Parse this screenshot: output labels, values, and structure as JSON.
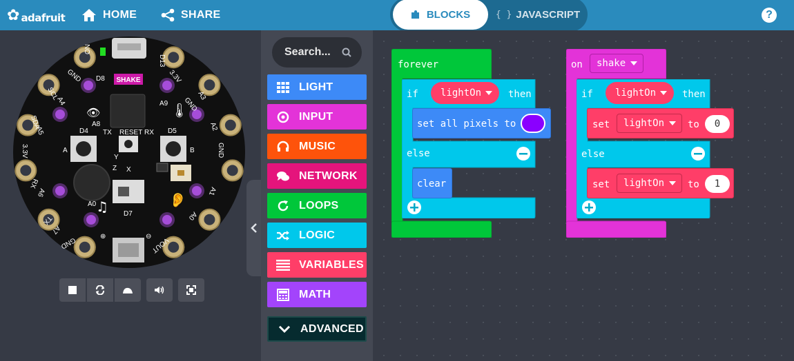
{
  "topbar": {
    "brand": "adafruit",
    "home_label": "HOME",
    "share_label": "SHARE",
    "tabs": {
      "blocks_label": "BLOCKS",
      "js_brace": "{ }",
      "javascript_label": "JAVASCRIPT"
    },
    "help_label": "?",
    "colors": {
      "bar": "#2a8bbd"
    }
  },
  "simulator": {
    "labels": {
      "on": "ON",
      "d13": "D13",
      "gnd_tl": "GND",
      "gnd_br": "GND",
      "gnd_bl": "GND",
      "gnd_r": "GND",
      "d8": "D8",
      "shake": "SHAKE",
      "v33_tr": "3.3V",
      "scl": "SCL",
      "a4": "A4",
      "a3": "A3",
      "a8": "A8",
      "a9": "A9",
      "sda": "SDA",
      "a5": "A5",
      "a2": "A2",
      "d4": "D4",
      "tx": "TX",
      "reset": "RESET",
      "rx": "RX",
      "d5": "D5",
      "btn_a": "A",
      "btn_b": "B",
      "v33_l": "3.3V",
      "rx_l": "RX",
      "a6": "A6",
      "a1": "A1",
      "y_axis": "Y",
      "z_axis": "Z",
      "x_axis": "X",
      "a0": "A0",
      "d7": "D7",
      "tx_l": "TX",
      "a7": "A7",
      "a0_r": "A0",
      "plus": "⊕",
      "minus": "⊖",
      "vout": "VOUT"
    },
    "led_color": "#a64dd9",
    "controls": [
      "stop-icon",
      "restart-icon",
      "slow-motion-icon",
      "mute-icon",
      "fullscreen-icon"
    ]
  },
  "toolbox": {
    "search_placeholder": "Search...",
    "categories": [
      {
        "label": "LIGHT",
        "color": "#3d8af7",
        "icon": "grid-icon"
      },
      {
        "label": "INPUT",
        "color": "#e333d8",
        "icon": "target-icon"
      },
      {
        "label": "MUSIC",
        "color": "#fe530b",
        "icon": "headphones-icon"
      },
      {
        "label": "NETWORK",
        "color": "#e5147c",
        "icon": "chat-icon"
      },
      {
        "label": "LOOPS",
        "color": "#00c73a",
        "icon": "refresh-icon"
      },
      {
        "label": "LOGIC",
        "color": "#00c8eb",
        "icon": "shuffle-icon"
      },
      {
        "label": "VARIABLES",
        "color": "#ff3e68",
        "icon": "list-icon"
      },
      {
        "label": "MATH",
        "color": "#a344fb",
        "icon": "calculator-icon"
      },
      {
        "label": "ADVANCED",
        "color": "#062b2f",
        "icon": "chevron-down-icon"
      }
    ]
  },
  "workspace": {
    "forever_block": {
      "hat_label": "forever",
      "if_label": "if",
      "condition_var": "lightOn",
      "then_label": "then",
      "set_pixels_label": "set all pixels to",
      "pixel_color": "#8a00ff",
      "else_label": "else",
      "clear_label": "clear"
    },
    "shake_block": {
      "on_label": "on",
      "event": "shake",
      "if_label": "if",
      "condition_var": "lightOn",
      "then_label": "then",
      "set_label": "set",
      "var_1": "lightOn",
      "to_label": "to",
      "value_1": "0",
      "else_label": "else",
      "var_2": "lightOn",
      "value_2": "1"
    },
    "colors": {
      "loops": "#00c73a",
      "logic": "#00c8eb",
      "light": "#3d8af7",
      "input": "#e333d8",
      "variables": "#ff3e68"
    }
  }
}
